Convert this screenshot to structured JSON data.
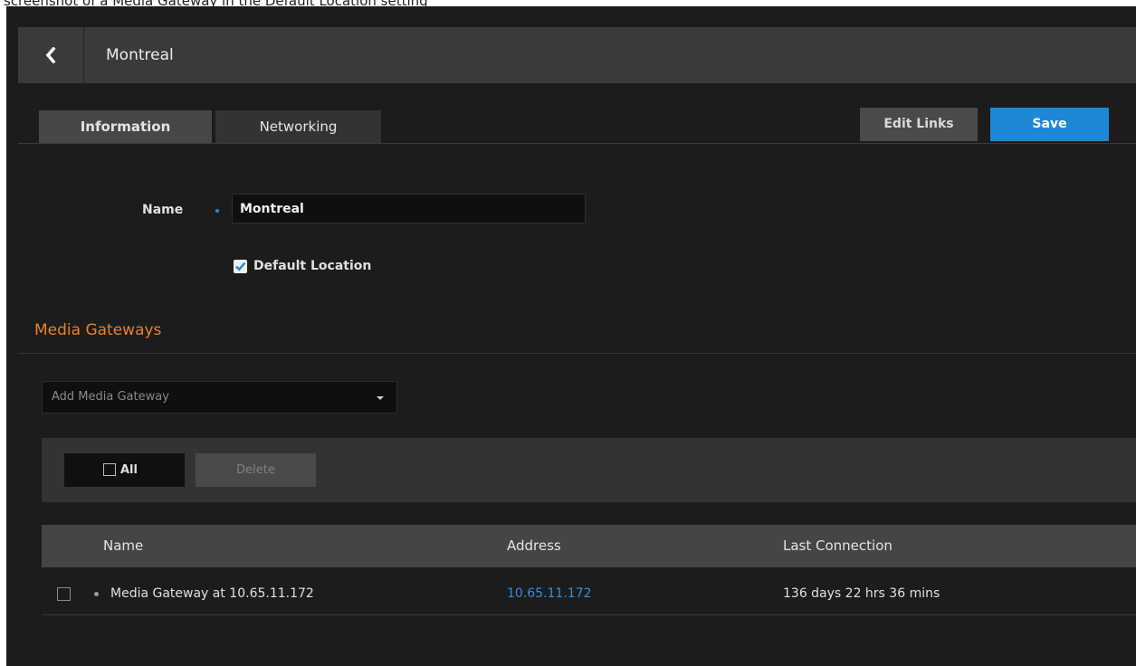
{
  "caption": "screenshot of a Media Gateway in the Default Location setting",
  "header": {
    "title": "Montreal"
  },
  "tabs": [
    {
      "label": "Information",
      "active": true
    },
    {
      "label": "Networking",
      "active": false
    }
  ],
  "actions": {
    "edit_links": "Edit Links",
    "save": "Save"
  },
  "form": {
    "name_label": "Name",
    "name_value": "Montreal",
    "default_location_label": "Default Location",
    "default_location_checked": true
  },
  "media_gateways": {
    "title": "Media Gateways",
    "dropdown_placeholder": "Add Media Gateway",
    "select_all_label": "All",
    "delete_label": "Delete",
    "columns": [
      "Name",
      "Address",
      "Last Connection"
    ],
    "rows": [
      {
        "name": "Media Gateway at 10.65.11.172",
        "address": "10.65.11.172",
        "last_connection": "136 days 22 hrs 36 mins"
      }
    ]
  },
  "colors": {
    "accent": "#1e88d6",
    "section_title": "#e8822a",
    "link": "#2e8fe0",
    "background": "#1c1c1c"
  }
}
